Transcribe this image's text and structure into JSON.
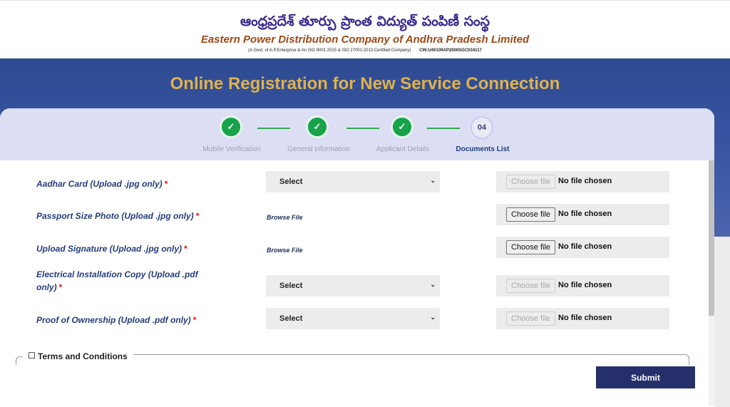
{
  "header": {
    "telugu_name": "ఆంధ్రప్రదేశ్ తూర్పు ప్రాంత విద్యుత్ పంపిణీ సంస్థ",
    "company_name": "Eastern Power Distribution Company of Andhra Pradesh Limited",
    "certification": "(A Govt. of A.P.Enterprise & An ISO 9001:2015 & ISO 27001:2013 Certified Company)",
    "cin": "CIN:U40109AP2000SGC034117"
  },
  "banner": {
    "title": "Online Registration for New Service Connection"
  },
  "stepper": {
    "steps": [
      {
        "label": "Mobile Verification",
        "status": "completed",
        "icon": "check-icon"
      },
      {
        "label": "General information",
        "status": "completed",
        "icon": "check-icon"
      },
      {
        "label": "Applicant Details",
        "status": "completed",
        "icon": "check-icon"
      },
      {
        "label": "Documents List",
        "status": "active",
        "number": "04"
      }
    ]
  },
  "documents": [
    {
      "label": "Aadhar Card (Upload .jpg only)",
      "control": "select",
      "select_value": "Select",
      "file_button": "Choose file",
      "file_status": "No file chosen",
      "file_enabled": false
    },
    {
      "label": "Passport Size Photo (Upload .jpg only)",
      "control": "browse",
      "browse_text": "Browse File",
      "file_button": "Choose file",
      "file_status": "No file chosen",
      "file_enabled": true
    },
    {
      "label": "Upload Signature (Upload .jpg only)",
      "control": "browse",
      "browse_text": "Browse File",
      "file_button": "Choose file",
      "file_status": "No file chosen",
      "file_enabled": true
    },
    {
      "label_line1": "Electrical Installation Copy (Upload .pdf",
      "label_line2": "only)",
      "control": "select",
      "select_value": "Select",
      "file_button": "Choose file",
      "file_status": "No file chosen",
      "file_enabled": false
    },
    {
      "label": "Proof of Ownership (Upload .pdf only)",
      "control": "select",
      "select_value": "Select",
      "file_button": "Choose file",
      "file_status": "No file chosen",
      "file_enabled": false
    }
  ],
  "required_marker": "*",
  "terms": {
    "label": "Terms and Conditions",
    "checked": false
  },
  "submit": {
    "label": "Submit"
  },
  "colors": {
    "accent": "#25306b",
    "title": "#e0b24a",
    "success": "#16a34a",
    "required": "#dd1111"
  }
}
